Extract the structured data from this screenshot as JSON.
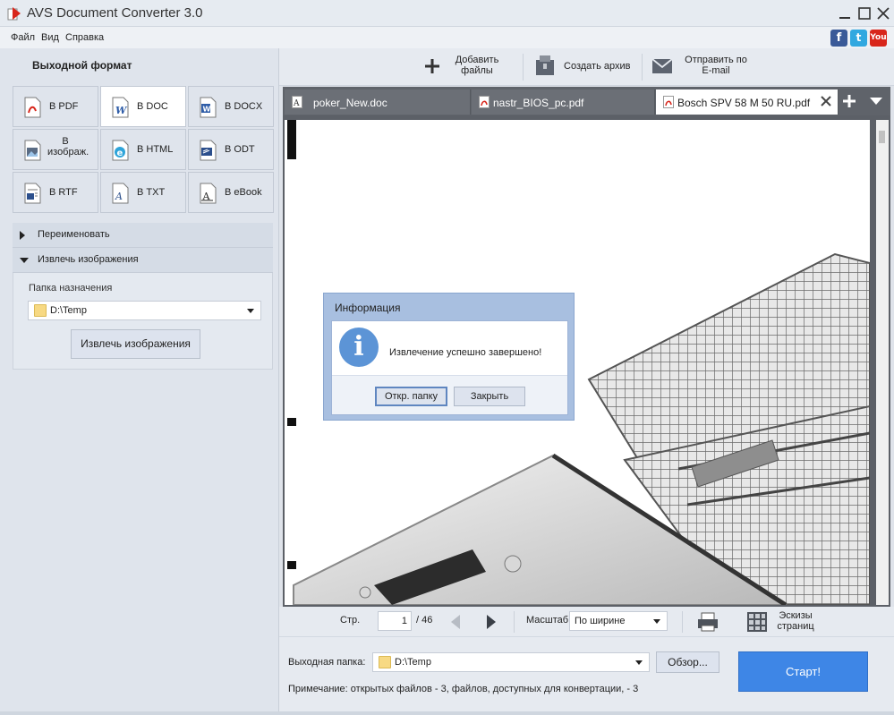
{
  "window": {
    "title": "AVS Document Converter 3.0"
  },
  "menu": {
    "items": [
      "Файл",
      "Вид",
      "Справка"
    ]
  },
  "social": {
    "facebook": "f",
    "twitter": "t",
    "youtube": "You"
  },
  "left": {
    "heading": "Выходной формат",
    "formats": [
      {
        "label": "В PDF",
        "icon": "pdf-icon",
        "active": false
      },
      {
        "label": "В DOC",
        "icon": "doc-icon",
        "active": true
      },
      {
        "label": "В DOCX",
        "icon": "docx-icon",
        "active": false
      },
      {
        "label": "В изображ.",
        "icon": "image-icon",
        "active": false
      },
      {
        "label": "В HTML",
        "icon": "html-icon",
        "active": false
      },
      {
        "label": "В ODT",
        "icon": "odt-icon",
        "active": false
      },
      {
        "label": "В RTF",
        "icon": "rtf-icon",
        "active": false
      },
      {
        "label": "В TXT",
        "icon": "txt-icon",
        "active": false
      },
      {
        "label": "В eBook",
        "icon": "ebook-icon",
        "active": false
      }
    ],
    "rename_label": "Переименовать",
    "extract_label": "Извлечь изображения",
    "dest_folder_label": "Папка назначения",
    "dest_folder_value": "D:\\Temp",
    "extract_button": "Извлечь изображения"
  },
  "toolbar": {
    "add_files": "Добавить файлы",
    "create_archive": "Создать архив",
    "send_email": "Отправить по E-mail"
  },
  "tabs": [
    {
      "label": "poker_New.doc",
      "type": "doc",
      "active": false
    },
    {
      "label": "nastr_BIOS_pc.pdf",
      "type": "pdf",
      "active": false
    },
    {
      "label": "Bosch SPV 58 M 50 RU.pdf",
      "type": "pdf",
      "active": true
    }
  ],
  "dialog": {
    "title": "Информация",
    "message": "Извлечение успешно завершено!",
    "open_folder": "Откр. папку",
    "close": "Закрыть"
  },
  "nav": {
    "page_label": "Стр.",
    "current_page": "1",
    "total_pages": "/ 46",
    "zoom_label": "Масштаб",
    "zoom_value": "По ширине",
    "thumbnails": "Эскизы страниц"
  },
  "bottom": {
    "output_label": "Выходная папка:",
    "output_value": "D:\\Temp",
    "browse": "Обзор...",
    "start": "Старт!",
    "note": "Примечание: открытых файлов - 3, файлов, доступных для конвертации, - 3"
  },
  "colors": {
    "accent": "#3e86e6",
    "dialog_frame": "#a8bfe0",
    "tab_bar": "#5f636a"
  }
}
